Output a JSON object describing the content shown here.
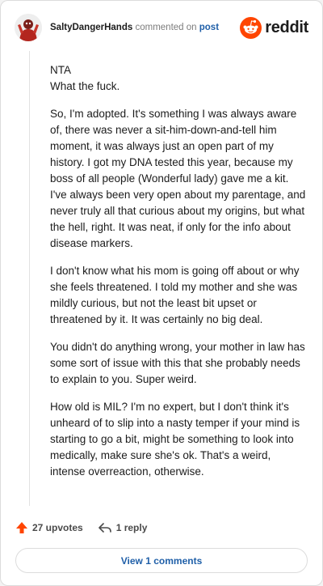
{
  "header": {
    "username": "SaltyDangerHands",
    "action_text": "commented on",
    "post_link": "post",
    "brand_text": "reddit",
    "brand_color": "#ff4500"
  },
  "comment": {
    "paragraphs": [
      "NTA\nWhat the fuck.",
      "So, I'm adopted. It's something I was always aware of, there was never a sit-him-down-and-tell him moment, it was always just an open part of my history. I got my DNA tested this year, because my boss of all people (Wonderful lady) gave me a kit. I've always been very open about my parentage, and never truly all that curious about my origins, but what the hell, right. It was neat, if only for the info about disease markers.",
      "I don't know what his mom is going off about or why she feels threatened. I told my mother and she was mildly curious, but not the least bit upset or threatened by it. It was certainly no big deal.",
      "You didn't do anything wrong, your mother in law has some sort of issue with this that she probably needs to explain to you. Super weird.",
      "How old is MIL? I'm no expert, but I don't think it's unheard of to slip into a nasty temper if your mind is starting to go a bit, might be something to look into medically, make sure she's ok. That's a weird, intense overreaction, otherwise."
    ]
  },
  "footer": {
    "upvotes": "27 upvotes",
    "replies": "1 reply",
    "view_comments": "View 1 comments",
    "upvote_color": "#ff4500",
    "link_color": "#1f5fa8"
  },
  "icons": {
    "avatar": "avatar-icon",
    "brand": "reddit-snoo-icon",
    "upvote": "upvote-arrow-icon",
    "reply": "reply-arrow-icon"
  }
}
